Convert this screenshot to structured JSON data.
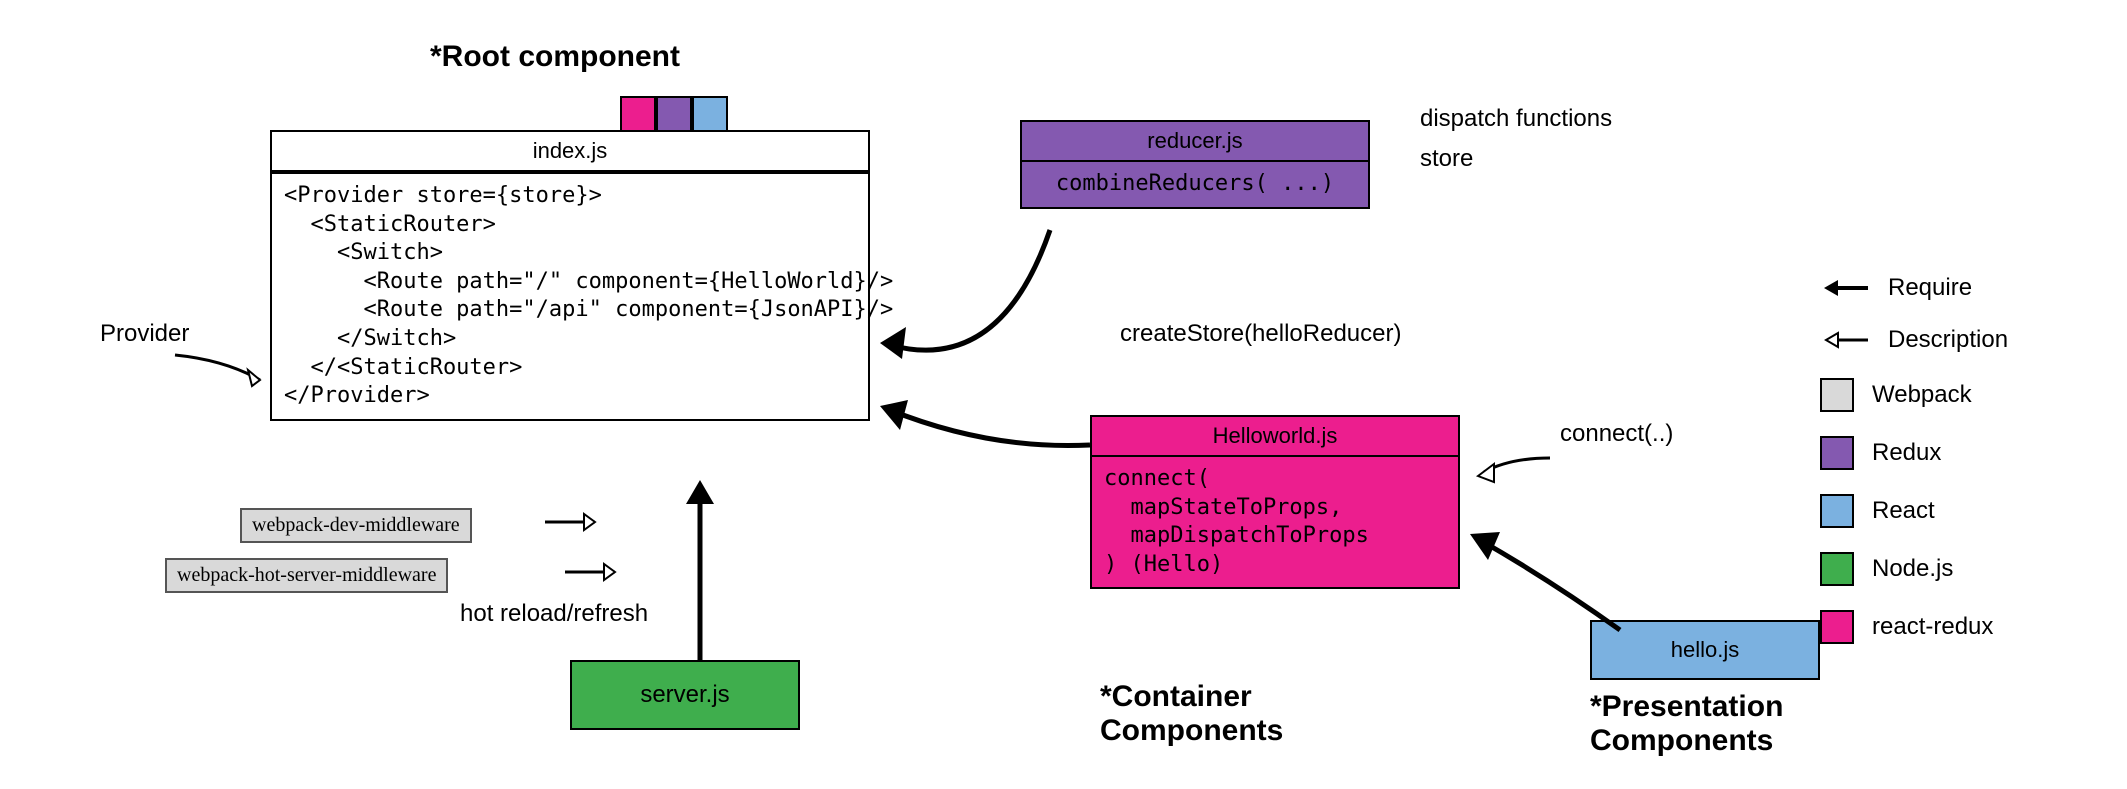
{
  "headlines": {
    "root": "*Root component",
    "container": "*Container\nComponents",
    "presentation": "*Presentation\nComponents"
  },
  "index": {
    "title": "index.js",
    "code": "<Provider store={store}>\n  <StaticRouter>\n    <Switch>\n      <Route path=\"/\" component={HelloWorld}/>\n      <Route path=\"/api\" component={JsonAPI}/>\n    </Switch>\n  </<StaticRouter>\n</Provider>"
  },
  "reducer": {
    "title": "reducer.js",
    "body": "combineReducers( ...)",
    "sidenote1": "dispatch functions",
    "sidenote2": "store"
  },
  "helloworld": {
    "title": "Helloworld.js",
    "body": "connect(\n  mapStateToProps,\n  mapDispatchToProps\n) (Hello)",
    "sidenote": "connect(..)"
  },
  "server": {
    "title": "server.js"
  },
  "hello": {
    "title": "hello.js"
  },
  "annotations": {
    "provider": "Provider",
    "createStore": "createStore(helloReducer)",
    "hotreload": "hot reload/refresh",
    "wdm": "webpack-dev-middleware",
    "whsm": "webpack-hot-server-middleware"
  },
  "legend": {
    "require": "Require",
    "description": "Description",
    "webpack": "Webpack",
    "redux": "Redux",
    "react": "React",
    "node": "Node.js",
    "reactredux": "react-redux"
  },
  "colors": {
    "pink": "#ec1e8e",
    "purple": "#8459b0",
    "blue": "#7bb1e0",
    "green": "#3fae4d",
    "gray": "#d9d9d9"
  }
}
